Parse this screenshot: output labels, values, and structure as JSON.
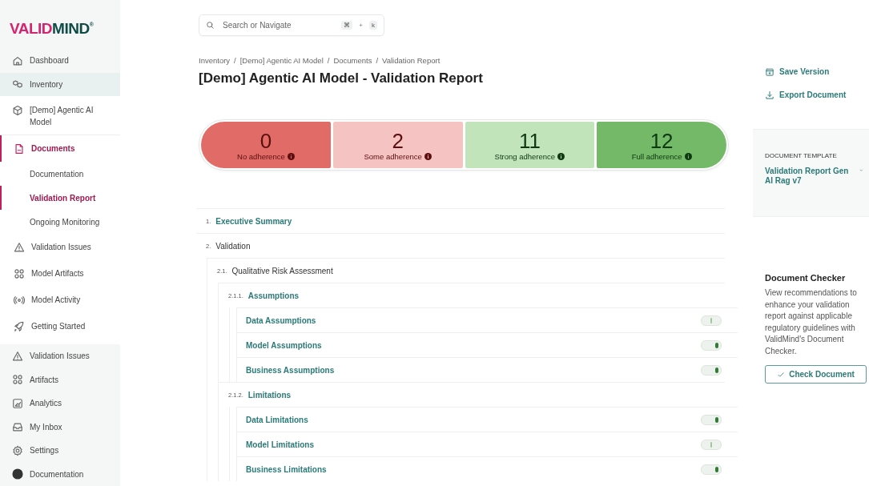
{
  "sidebar": {
    "logo": {
      "part1": "VALID",
      "part2": "MIND",
      "mark": "®"
    },
    "top_items": [
      {
        "label": "Dashboard",
        "selected": false
      },
      {
        "label": "Inventory",
        "selected": true
      }
    ],
    "model_panel": {
      "title": "[Demo] Agentic AI Model",
      "items": [
        {
          "label": "Documents",
          "selected": true,
          "children": [
            {
              "label": "Documentation",
              "selected": false
            },
            {
              "label": "Validation Report",
              "selected": true
            },
            {
              "label": "Ongoing Monitoring",
              "selected": false
            }
          ]
        },
        {
          "label": "Validation Issues",
          "selected": false
        },
        {
          "label": "Model Artifacts",
          "selected": false
        },
        {
          "label": "Model Activity",
          "selected": false
        },
        {
          "label": "Getting Started",
          "selected": false
        }
      ]
    },
    "bottom_items": [
      {
        "label": "Validation Issues",
        "selected": false
      },
      {
        "label": "Artifacts",
        "selected": false
      },
      {
        "label": "Analytics",
        "selected": false
      },
      {
        "label": "My Inbox",
        "selected": false
      },
      {
        "label": "Settings",
        "selected": false
      },
      {
        "label": "Documentation",
        "selected": false
      }
    ]
  },
  "search": {
    "placeholder": "Search or Navigate",
    "keys": [
      "⌘",
      "+",
      "k"
    ]
  },
  "breadcrumbs": [
    "Inventory",
    "[Demo] Agentic AI Model",
    "Documents",
    "Validation Report"
  ],
  "breadcrumb_separator": "/",
  "title": "[Demo] Agentic AI Model - Validation Report",
  "adherence": [
    {
      "count": "0",
      "label": "No adherence",
      "color": "#e06b67"
    },
    {
      "count": "2",
      "label": "Some adherence",
      "color": "#f5c3c2"
    },
    {
      "count": "11",
      "label": "Strong adherence",
      "color": "#c2e4bb"
    },
    {
      "count": "12",
      "label": "Full adherence",
      "color": "#74b968"
    }
  ],
  "sections": [
    {
      "number": "1.",
      "title": "Executive Summary",
      "kind": "link"
    },
    {
      "number": "2.",
      "title": "Validation",
      "kind": "group",
      "children": [
        {
          "number": "2.1.",
          "title": "Qualitative Risk Assessment",
          "kind": "group",
          "children": [
            {
              "number": "2.1.1.",
              "title": "Assumptions",
              "kind": "link",
              "children": [
                {
                  "title": "Data Assumptions",
                  "kind": "leaf",
                  "checked": false
                },
                {
                  "title": "Model Assumptions",
                  "kind": "leaf",
                  "checked": true
                },
                {
                  "title": "Business Assumptions",
                  "kind": "leaf",
                  "checked": true
                }
              ]
            },
            {
              "number": "2.1.2.",
              "title": "Limitations",
              "kind": "link",
              "children": [
                {
                  "title": "Data Limitations",
                  "kind": "leaf",
                  "checked": true
                },
                {
                  "title": "Model Limitations",
                  "kind": "leaf",
                  "checked": false
                },
                {
                  "title": "Business Limitations",
                  "kind": "leaf",
                  "checked": true
                }
              ]
            }
          ]
        }
      ]
    }
  ],
  "actions": [
    "Save Version",
    "Export Document"
  ],
  "template": {
    "label": "DOCUMENT TEMPLATE",
    "value": "Validation Report Gen AI Rag v7"
  },
  "checker": {
    "title": "Document Checker",
    "text": "View recommendations to enhance your validation report against applicable regulatory guidelines with ValidMind's Document Checker.",
    "button": "Check Document"
  }
}
